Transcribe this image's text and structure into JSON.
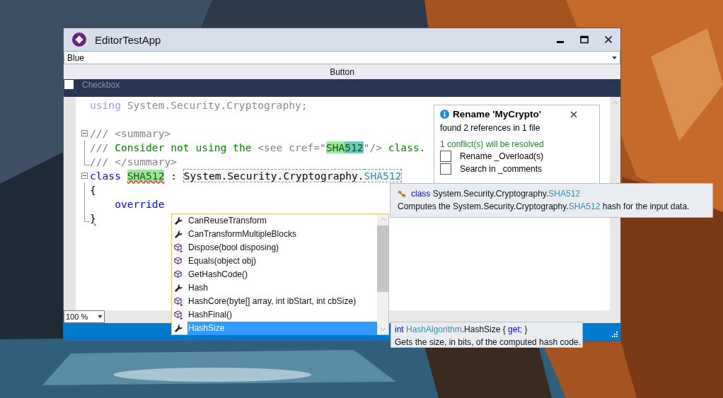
{
  "window": {
    "title": "EditorTestApp"
  },
  "dropdown": {
    "value": "Blue"
  },
  "button": {
    "label": "Button"
  },
  "checkbox": {
    "label": "Checkbox",
    "checked": false
  },
  "code_lines": [
    {
      "kind": "plain",
      "tokens": [
        {
          "kind": "dim-keyword",
          "text": "using"
        },
        {
          "kind": "dim",
          "text": " System.Security.Cryptography;"
        }
      ]
    },
    {
      "kind": "plain"
    },
    {
      "kind": "fold-start",
      "tokens": [
        {
          "kind": "comment-dim",
          "text": "/// <summary>"
        }
      ]
    },
    {
      "kind": "fold-inner",
      "tokens": [
        {
          "kind": "comment-dim",
          "text": "/// "
        },
        {
          "kind": "comment",
          "text": "Consider not using the "
        },
        {
          "kind": "comment-dim",
          "text": "<see cref=\""
        },
        {
          "kind": "ref-a",
          "text": "SHA"
        },
        {
          "kind": "ref-b",
          "text": "512"
        },
        {
          "kind": "comment-dim",
          "text": "\"/> "
        },
        {
          "kind": "comment",
          "text": "class."
        }
      ]
    },
    {
      "kind": "fold-end",
      "tokens": [
        {
          "kind": "comment-dim",
          "text": "/// </summary>"
        }
      ]
    },
    {
      "kind": "fold-start",
      "tokens": [
        {
          "kind": "keyword",
          "text": "class "
        },
        {
          "kind": "rename-def",
          "text": "SHA512"
        },
        {
          "kind": "plain",
          "text": " : "
        },
        {
          "kind": "rename-box",
          "text": "System.Security.Cryptography."
        },
        {
          "kind": "rename-box-type",
          "text": "SHA512"
        }
      ]
    },
    {
      "kind": "fold-inner",
      "tokens": [
        {
          "kind": "plain",
          "text": "{"
        }
      ]
    },
    {
      "kind": "fold-inner",
      "tokens": [
        {
          "kind": "keyword",
          "text": "    override"
        }
      ]
    },
    {
      "kind": "fold-end",
      "tokens": [
        {
          "kind": "error",
          "text": "}"
        }
      ]
    }
  ],
  "rename_popup": {
    "title": "Rename 'MyCrypto'",
    "summary": "found 2 references in 1 file",
    "conflicts": "1 conflict(s) will be resolved",
    "options": [
      {
        "label": "Rename _Overload(s)",
        "checked": false
      },
      {
        "label": "Search in _comments",
        "checked": false
      }
    ]
  },
  "class_tooltip": {
    "lines": [
      [
        {
          "kind": "keyword",
          "text": "class"
        },
        {
          "kind": "plain",
          "text": " System.Security.Cryptography."
        },
        {
          "kind": "type",
          "text": "SHA512"
        }
      ],
      [
        {
          "kind": "plain",
          "text": "Computes the System.Security.Cryptography."
        },
        {
          "kind": "type",
          "text": "SHA512"
        },
        {
          "kind": "plain",
          "text": " hash for the input data."
        }
      ]
    ]
  },
  "completion": {
    "items": [
      {
        "label": "CanReuseTransform",
        "kind": "property",
        "selected": false
      },
      {
        "label": "CanTransformMultipleBlocks",
        "kind": "property",
        "selected": false
      },
      {
        "label": "Dispose(bool disposing)",
        "kind": "method-protected",
        "selected": false
      },
      {
        "label": "Equals(object obj)",
        "kind": "method",
        "selected": false
      },
      {
        "label": "GetHashCode()",
        "kind": "method",
        "selected": false
      },
      {
        "label": "Hash",
        "kind": "property",
        "selected": false
      },
      {
        "label": "HashCore(byte[] array, int ibStart, int cbSize)",
        "kind": "method-protected",
        "selected": false
      },
      {
        "label": "HashFinal()",
        "kind": "method-protected",
        "selected": false
      },
      {
        "label": "HashSize",
        "kind": "property",
        "selected": true
      }
    ]
  },
  "member_tooltip": {
    "lines": [
      [
        {
          "kind": "keyword",
          "text": "int "
        },
        {
          "kind": "type",
          "text": "HashAlgorithm"
        },
        {
          "kind": "plain",
          "text": ".HashSize { "
        },
        {
          "kind": "keyword",
          "text": "get;"
        },
        {
          "kind": "plain",
          "text": " }"
        }
      ],
      [
        {
          "kind": "plain",
          "text": "Gets the size, in bits, of the computed hash code."
        }
      ]
    ]
  },
  "zoom": {
    "value": "100 %"
  }
}
